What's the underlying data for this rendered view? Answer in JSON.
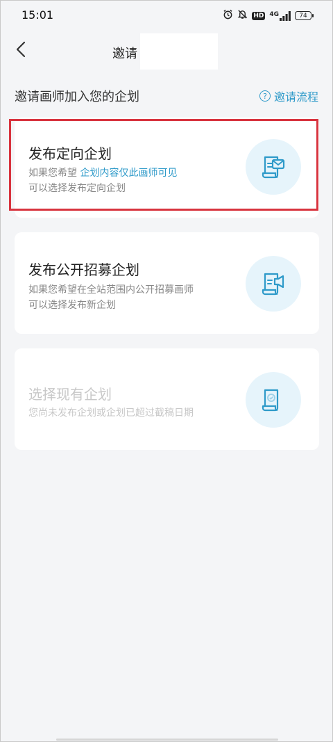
{
  "status_bar": {
    "time": "15:01",
    "hd": "HD",
    "network": "4G",
    "battery": "74",
    "icons": [
      "alarm-icon",
      "mute-bell-icon",
      "hd-icon",
      "signal-icon",
      "battery-icon"
    ]
  },
  "nav": {
    "title": "邀请",
    "back_icon": "chevron-left-icon"
  },
  "section": {
    "title": "邀请画师加入您的企划",
    "help_label": "邀请流程",
    "help_icon": "question-circle-icon"
  },
  "cards": [
    {
      "title": "发布定向企划",
      "desc_line1_prefix": "如果您希望 ",
      "desc_line1_highlight": "企划内容仅此画师可见",
      "desc_line2": "可以选择发布定向企划",
      "icon": "document-mail-icon",
      "enabled": true
    },
    {
      "title": "发布公开招募企划",
      "desc_line1": "如果您希望在全站范围内公开招募画师",
      "desc_line2": "可以选择发布新企划",
      "icon": "document-megaphone-icon",
      "enabled": true
    },
    {
      "title": "选择现有企划",
      "desc_line1": "您尚未发布企划或企划已超过截稿日期",
      "icon": "document-check-icon",
      "enabled": false
    }
  ],
  "colors": {
    "accent": "#2e9ac9",
    "highlight_border": "#d8333e",
    "icon_bg": "#e6f4fb",
    "disabled_text": "#c8c8c8",
    "page_bg": "#f4f5f7"
  }
}
